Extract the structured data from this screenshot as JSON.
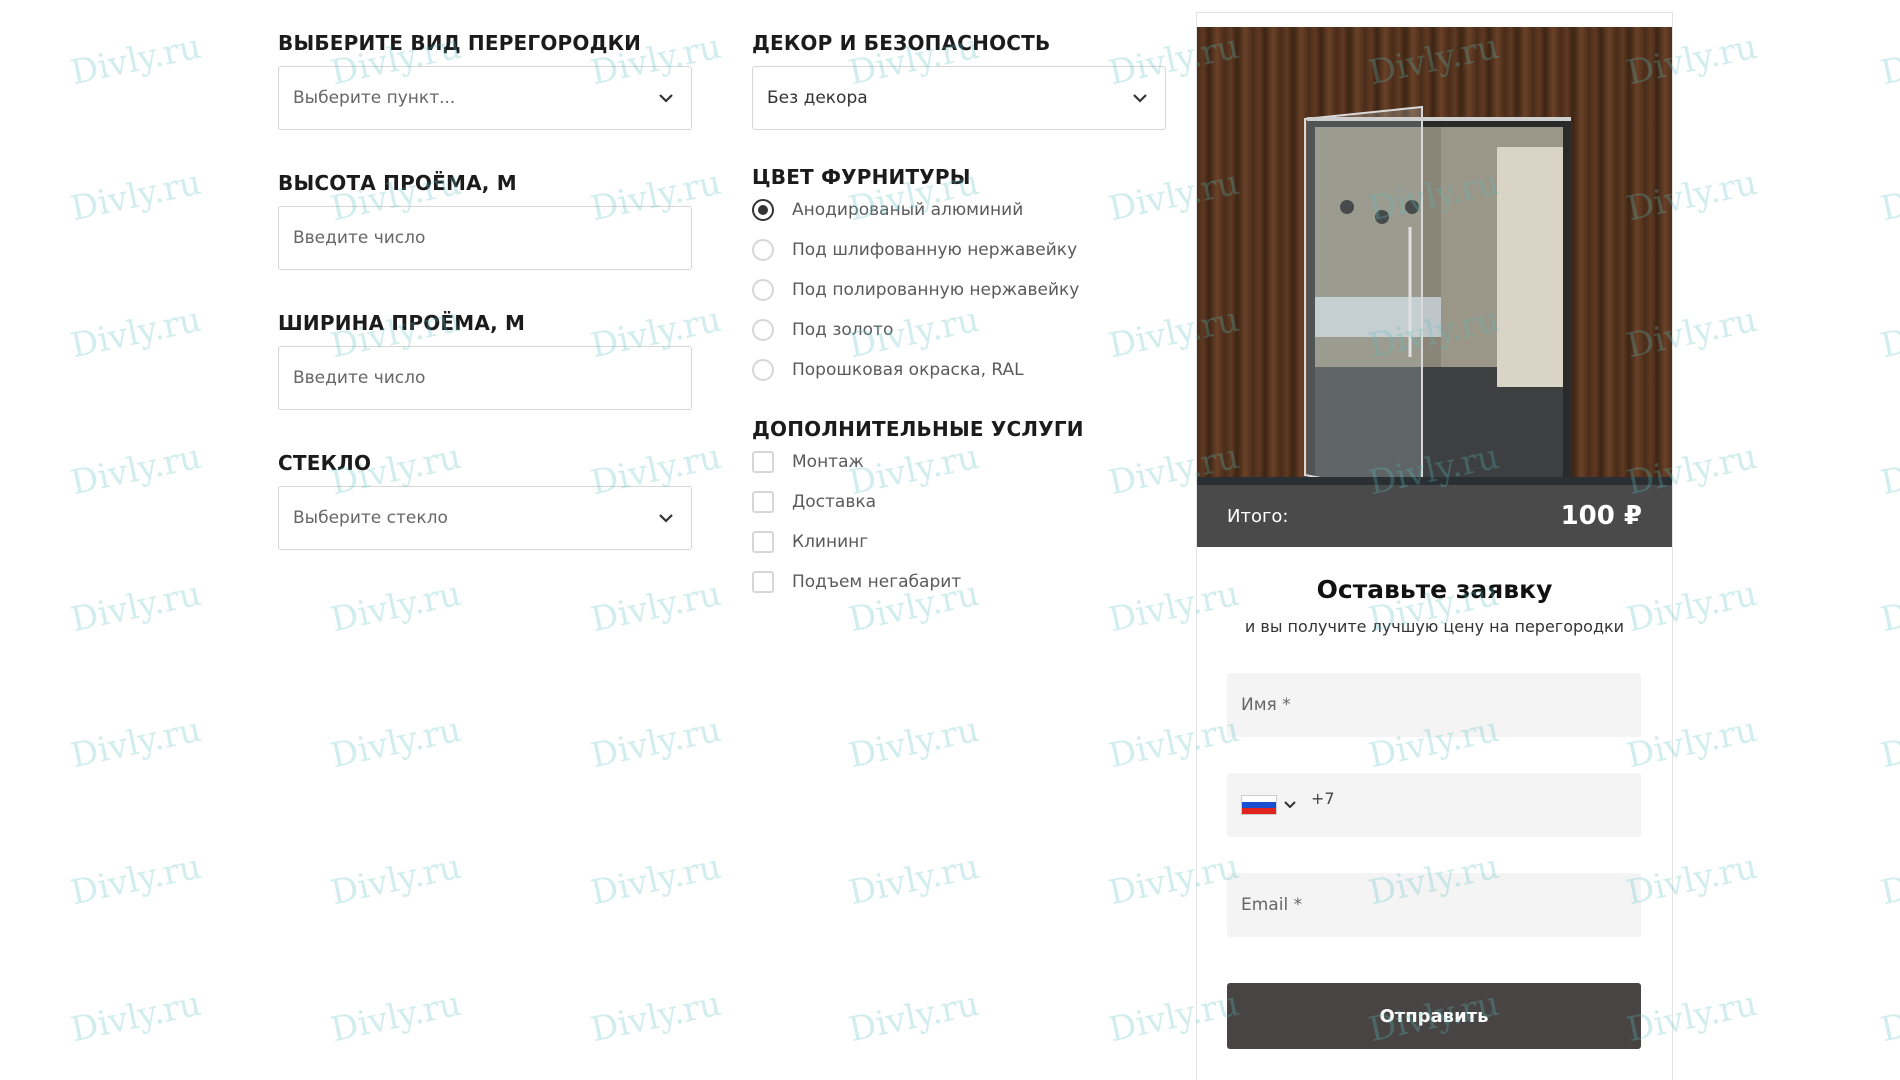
{
  "partition_type": {
    "title": "ВЫБЕРИТЕ ВИД ПЕРЕГОРОДКИ",
    "placeholder": "Выберите пункт..."
  },
  "height": {
    "title": "ВЫСОТА ПРОЁМА, М",
    "placeholder": "Введите число"
  },
  "width": {
    "title": "ШИРИНА ПРОЁМА, М",
    "placeholder": "Введите число"
  },
  "glass": {
    "title": "СТЕКЛО",
    "placeholder": "Выберите стекло"
  },
  "decor": {
    "title": "ДЕКОР И БЕЗОПАСНОСТЬ",
    "value": "Без декора"
  },
  "fittings": {
    "title": "ЦВЕТ ФУРНИТУРЫ",
    "options": [
      {
        "label": "Анодированый алюминий",
        "selected": true
      },
      {
        "label": "Под шлифованную нержавейку",
        "selected": false
      },
      {
        "label": "Под полированную нержавейку",
        "selected": false
      },
      {
        "label": "Под золото",
        "selected": false
      },
      {
        "label": "Порошковая окраска, RAL",
        "selected": false
      }
    ]
  },
  "services": {
    "title": "ДОПОЛНИТЕЛЬНЫЕ УСЛУГИ",
    "options": [
      {
        "label": "Монтаж",
        "checked": false
      },
      {
        "label": "Доставка",
        "checked": false
      },
      {
        "label": "Клининг",
        "checked": false
      },
      {
        "label": "Подъем негабарит",
        "checked": false
      }
    ]
  },
  "summary": {
    "total_label": "Итого:",
    "total_value": "100 ₽"
  },
  "request_form": {
    "title": "Оставьте заявку",
    "subtitle": "и вы получите лучшую цену на перегородки",
    "name_placeholder": "Имя *",
    "phone_code": "+7",
    "email_placeholder": "Email *",
    "submit_label": "Отправить"
  },
  "watermark": "Divly.ru",
  "colors": {
    "accent_dark": "#494444",
    "total_bar": "#4a4a4a",
    "watermark": "#5abebe"
  }
}
